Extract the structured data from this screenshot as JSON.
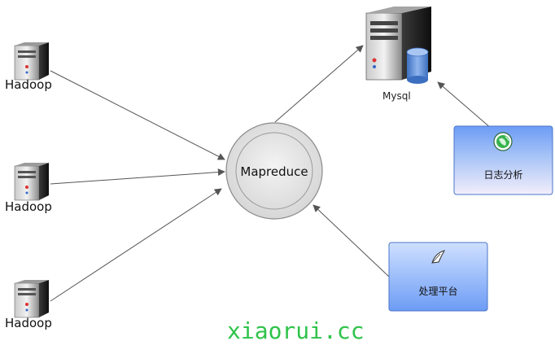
{
  "nodes": {
    "hadoop_1": {
      "label": "Hadoop"
    },
    "hadoop_2": {
      "label": "Hadoop"
    },
    "hadoop_3": {
      "label": "Hadoop"
    },
    "center": {
      "label": "Mapreduce"
    },
    "mysql": {
      "label": "Mysql"
    },
    "log_analysis": {
      "label": "日志分析",
      "icon": "globe-icon"
    },
    "processing_platform": {
      "label": "处理平台",
      "icon": "feather-icon"
    }
  },
  "watermark": "xiaorui.cc",
  "colors": {
    "arrow": "#555555",
    "card_top": "#cfe0ff",
    "card_bottom": "#6d9cf5",
    "watermark": "#2fc34a"
  }
}
